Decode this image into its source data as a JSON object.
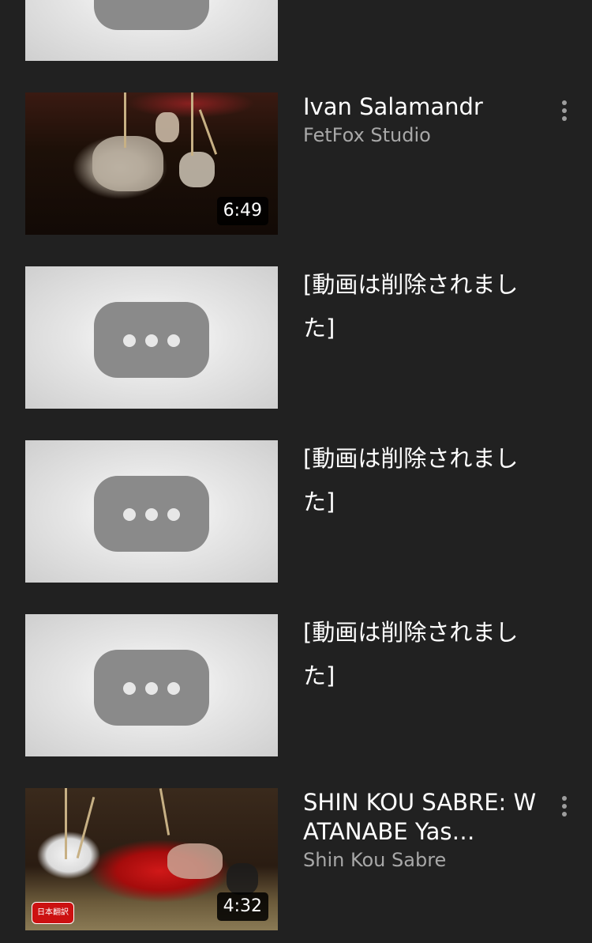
{
  "videos": [
    {
      "kind": "placeholder",
      "title": "",
      "channel": "",
      "duration": ""
    },
    {
      "kind": "photo",
      "title": "Ivan Salamandr",
      "channel": "FetFox Studio",
      "duration": "6:49"
    },
    {
      "kind": "placeholder",
      "title": "[動画は削除されました]",
      "channel": "",
      "duration": ""
    },
    {
      "kind": "placeholder",
      "title": "[動画は削除されました]",
      "channel": "",
      "duration": ""
    },
    {
      "kind": "placeholder",
      "title": "[動画は削除されました]",
      "channel": "",
      "duration": ""
    },
    {
      "kind": "photo",
      "title": "SHIN KOU SABRE: WATANABE Yas…",
      "channel": "Shin Kou Sabre",
      "duration": "4:32",
      "badge": "日本翻訳"
    }
  ],
  "icons": {
    "menu": "more-vert-icon",
    "placeholder": "unavailable-video-icon"
  },
  "colors": {
    "background": "#212121",
    "title": "#ffffff",
    "channel": "#a8a8a8",
    "badge": "#cc1111"
  }
}
